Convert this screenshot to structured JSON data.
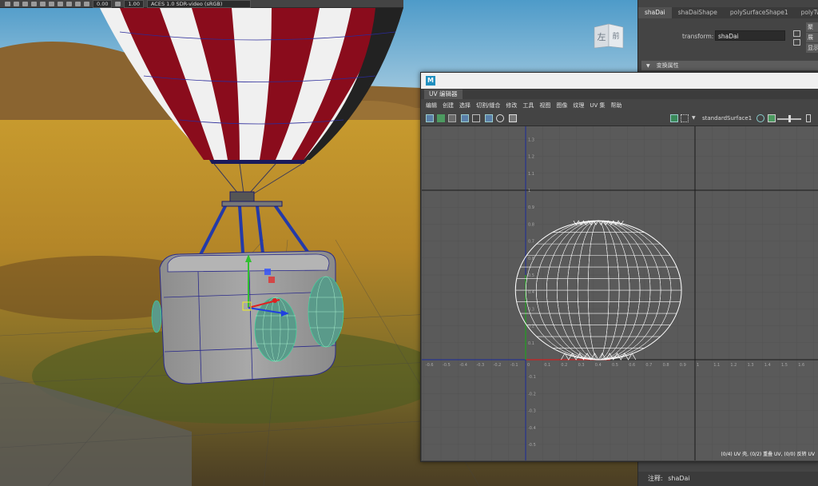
{
  "viewport": {
    "toolbar": {
      "field_value_a": "0.00",
      "field_value_b": "1.00",
      "color_space": "ACES 1.0 SDR-video (sRGB)"
    },
    "view_cube": {
      "left_face": "左",
      "front_face": "前"
    }
  },
  "attribute_editor": {
    "tabs": [
      "shaDai",
      "shaDaiShape",
      "polySurfaceShape1",
      "polyTwe"
    ],
    "transform_label": "transform:",
    "transform_value": "shaDai",
    "side_buttons": [
      "聚",
      "展",
      "显示"
    ],
    "section_header": "变换属性",
    "notes_label": "注释:",
    "notes_value": "shaDai"
  },
  "uv_editor": {
    "tab_label": "UV 编辑器",
    "menus": [
      "编辑",
      "创建",
      "选择",
      "切割/缝合",
      "修改",
      "工具",
      "视图",
      "图像",
      "纹理",
      "UV 集",
      "帮助"
    ],
    "shader_name": "standardSurface1",
    "status_text": "(0/4) UV 壳, (0/2) 重叠 UV, (0/0) 反转 UV",
    "ticks_u": [
      "-0.6",
      "-0.5",
      "-0.4",
      "-0.3",
      "-0.2",
      "-0.1",
      "0",
      "0.1",
      "0.2",
      "0.3",
      "0.4",
      "0.5",
      "0.6",
      "0.7",
      "0.8",
      "0.9",
      "1",
      "1.1",
      "1.2",
      "1.3",
      "1.4",
      "1.5",
      "1.6"
    ],
    "ticks_v": [
      "1.3",
      "1.2",
      "1.1",
      "1",
      "0.9",
      "0.8",
      "0.7",
      "0.6",
      "0.5",
      "0.4",
      "0.3",
      "0.2",
      "0.1",
      "-0.1",
      "-0.2",
      "-0.3",
      "-0.4",
      "-0.5"
    ]
  },
  "colors": {
    "uv_axis_u": "#cc2020",
    "uv_axis_v": "#20a020",
    "uv_axis_neg": "#1a2a9a",
    "uv_wire": "#ffffff",
    "balloon_red": "#8a0c1c",
    "selection_wire": "#36e0a0"
  }
}
